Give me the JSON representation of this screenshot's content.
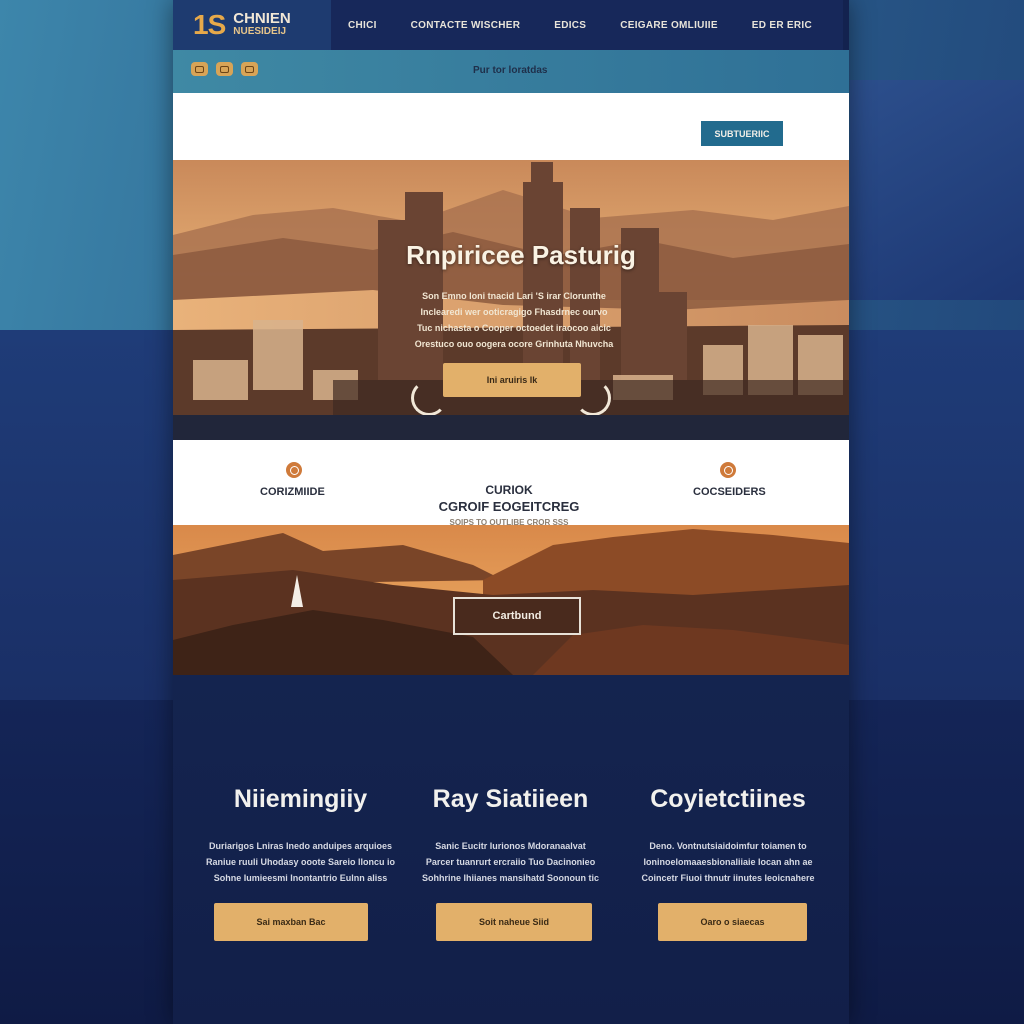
{
  "brand": {
    "mark": "1S",
    "name": "CHNIEN",
    "tag": "NUESIDEIJ"
  },
  "nav": {
    "links": [
      "CHICI",
      "CONTACTE WISCHER",
      "EDICS",
      "CEIGARE OMLIUIIE",
      "ED ER ERIC"
    ]
  },
  "utility": {
    "icons": [
      "bag-icon",
      "cart-icon",
      "mail-icon"
    ],
    "text": "Pur tor loratdas"
  },
  "header": {
    "subscribe_label": "SUBTUERIIC"
  },
  "hero": {
    "title": "Rnpiricee Pasturig",
    "body": [
      "Son Emno loni tnacid Lari 'S irar Clorunthe",
      "Inclearedi wer ooticragigo Fhasdrnec ourvo",
      "Tuc nichasta o Cooper octoedet iraocoo aicic",
      "Orestuco ouo oogera ocore Grinhuta Nhuvcha"
    ],
    "button_label": "Ini aruiris Ik"
  },
  "features": {
    "left": {
      "icon": "location-icon",
      "label": "CORIZMIIDE"
    },
    "center": {
      "line1": "CURIOK",
      "line2": "CGROIF EOGEITCREG",
      "line3": "SOIPS TO OUTLIBE CROR SSS"
    },
    "right": {
      "icon": "chat-icon",
      "label": "COCSEIDERS"
    }
  },
  "landscape": {
    "cta_label": "Cartbund"
  },
  "columns": [
    {
      "title": "Niiemingiiy",
      "body": [
        "Duriarigos Lniras Inedo anduipes arquioes",
        "Raniue ruuli Uhodasy ooote Sareio lloncu io",
        "Sohne Iumieesmi Inontantrio Eulnn aliss"
      ],
      "button": "Sai maxban Bac"
    },
    {
      "title": "Ray Siatiieen",
      "body": [
        "Sanic Eucitr Iurionos Mdoranaalvat",
        "Parcer tuanrurt ercraiio Tuo Dacinonieo",
        "Sohhrine Ihiianes mansihatd Soonoun tic"
      ],
      "button": "Soit naheue Siid"
    },
    {
      "title": "Coyietctiines",
      "body": [
        "Deno. Vontnutsiaidoimfur toiamen to",
        "Ioninoelomaaesbionaliiaie Iocan ahn ae",
        "Coincetr Fiuoi thnutr iinutes leoicnahere"
      ],
      "button": "Oaro o siaecas"
    }
  ]
}
